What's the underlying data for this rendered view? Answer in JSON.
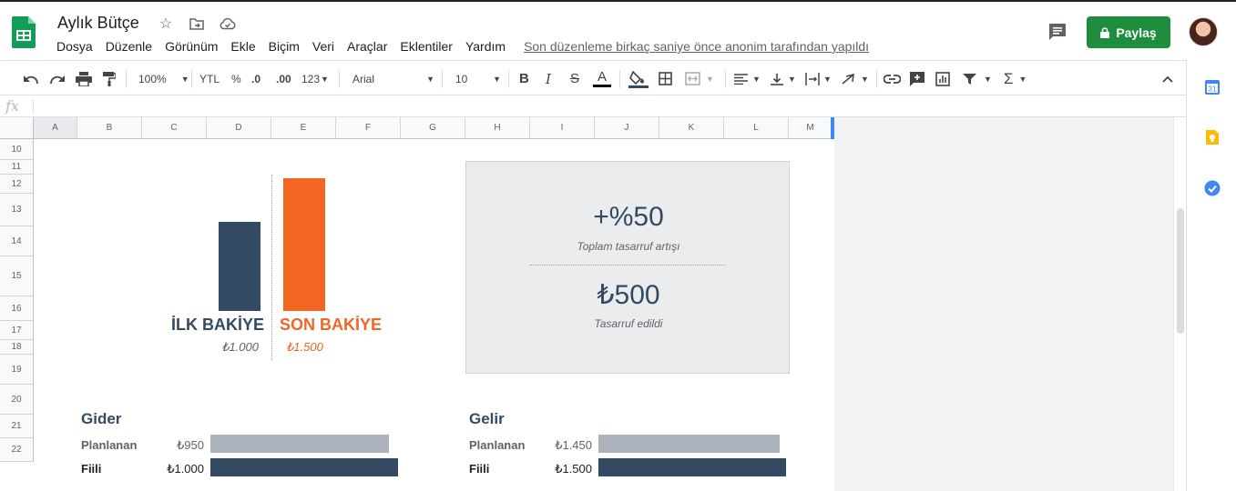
{
  "app": {
    "doc_title": "Aylık Bütçe",
    "menu": [
      "Dosya",
      "Düzenle",
      "Görünüm",
      "Ekle",
      "Biçim",
      "Veri",
      "Araçlar",
      "Eklentiler",
      "Yardım"
    ],
    "last_edit": "Son düzenleme birkaç saniye önce anonim tarafından yapıldı",
    "share_label": "Paylaş"
  },
  "toolbar": {
    "zoom": "100%",
    "currency": "YTL",
    "percent": "%",
    "dec_decrease": ".0",
    "dec_increase": ".00",
    "more_formats": "123",
    "font": "Arial",
    "font_size": "10"
  },
  "formula_bar": {
    "fx": "fx"
  },
  "grid": {
    "columns": [
      "A",
      "B",
      "C",
      "D",
      "E",
      "F",
      "G",
      "H",
      "I",
      "J",
      "K",
      "L",
      "M"
    ],
    "rows": [
      "10",
      "11",
      "12",
      "13",
      "14",
      "15",
      "16",
      "17",
      "18",
      "19",
      "20",
      "21",
      "22"
    ]
  },
  "dashboard": {
    "start_balance_label": "İLK BAKİYE",
    "start_balance_value": "₺1.000",
    "end_balance_label": "SON BAKİYE",
    "end_balance_value": "₺1.500",
    "balance_amounts": [
      1000,
      1500
    ],
    "savings_percent": "+%50",
    "savings_percent_caption": "Toplam tasarruf artışı",
    "savings_amount": "₺500",
    "savings_amount_caption": "Tasarruf edildi",
    "expense": {
      "title": "Gider",
      "planned_label": "Planlanan",
      "planned_value": "₺950",
      "planned_amount": 950,
      "actual_label": "Fiili",
      "actual_value": "₺1.000",
      "actual_amount": 1000
    },
    "income": {
      "title": "Gelir",
      "planned_label": "Planlanan",
      "planned_value": "₺1.450",
      "planned_amount": 1450,
      "actual_label": "Fiili",
      "actual_value": "₺1.500",
      "actual_amount": 1500
    }
  },
  "colors": {
    "navy": "#334a63",
    "orange": "#f26522",
    "share_green": "#1e8e3e"
  }
}
